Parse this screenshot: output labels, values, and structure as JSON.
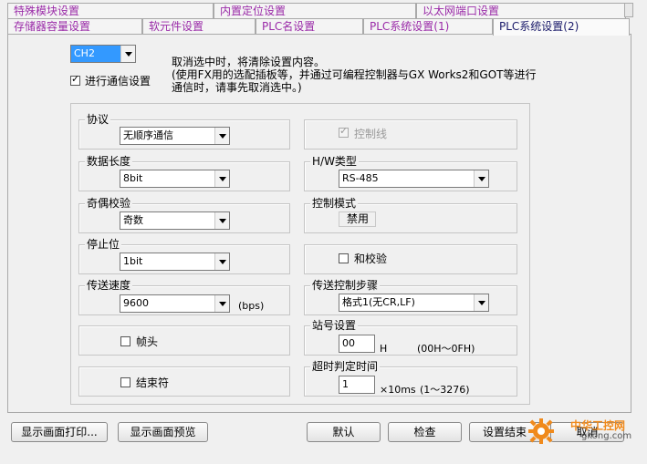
{
  "tabs_row1": [
    "特殊模块设置",
    "内置定位设置",
    "以太网端口设置"
  ],
  "tabs_row2": [
    "存储器容量设置",
    "软元件设置",
    "PLC名设置",
    "PLC系统设置(1)",
    "PLC系统设置(2)"
  ],
  "channel": {
    "value": "CH2"
  },
  "notice": {
    "line1": "取消选中时，将清除设置内容。",
    "line2": "(使用FX用的选配插板等，并通过可编程控制器与GX Works2和GOT等进行",
    "line3": "通信时，请事先取消选中。)"
  },
  "comm_setting": {
    "label": "进行通信设置",
    "checked": true
  },
  "protocol": {
    "label": "协议",
    "value": "无顺序通信"
  },
  "data_length": {
    "label": "数据长度",
    "value": "8bit"
  },
  "parity": {
    "label": "奇偶校验",
    "value": "奇数"
  },
  "stop_bit": {
    "label": "停止位",
    "value": "1bit"
  },
  "baud_rate": {
    "label": "传送速度",
    "value": "9600",
    "unit": "(bps)"
  },
  "header": {
    "label": "帧头"
  },
  "terminator": {
    "label": "结束符"
  },
  "control_line": {
    "label": "控制线"
  },
  "hw_type": {
    "label": "H/W类型",
    "value": "RS-485"
  },
  "control_mode": {
    "label": "控制模式",
    "value": "禁用"
  },
  "sum_check": {
    "label": "和校验"
  },
  "transmission_control": {
    "label": "传送控制步骤",
    "value": "格式1(无CR,LF)"
  },
  "station_no": {
    "label": "站号设置",
    "value": "00",
    "unit": "H",
    "range": "(00H～0FH)"
  },
  "timeout": {
    "label": "超时判定时间",
    "value": "1",
    "unit": "×10ms",
    "range": "(1～3276)"
  },
  "buttons": {
    "print": "显示画面打印...",
    "preview": "显示画面预览",
    "default": "默认",
    "check": "检查",
    "finish": "设置结束",
    "cancel": "取消"
  },
  "watermark": {
    "text": "中华工控网",
    "subtext": "gkong.com"
  },
  "colors": {
    "tab_text": "#9a2aa8",
    "watermark_orange": "#f08a1c",
    "selection_blue": "#3399ff"
  }
}
